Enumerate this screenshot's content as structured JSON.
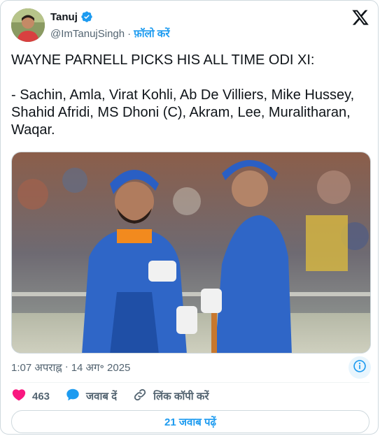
{
  "author": {
    "name": "Tanuj",
    "handle": "@ImTanujSingh",
    "follow_label": "फ़ॉलो करें",
    "separator": "·"
  },
  "tweet": {
    "text": "WAYNE PARNELL PICKS HIS ALL TIME ODI XI:\n\n- Sachin, Amla, Virat Kohli, Ab De Villiers, Mike Hussey, Shahid Afridi, MS Dhoni (C), Akram, Lee, Muralitharan, Waqar."
  },
  "meta": {
    "time": "1:07 अपराह्न",
    "separator": "·",
    "date": "14 अग॰ 2025"
  },
  "actions": {
    "like_count": "463",
    "reply_label": "जवाब दें",
    "copy_link_label": "लिंक कॉपी करें"
  },
  "replies_button": {
    "label": "21 जवाब पढ़ें"
  },
  "colors": {
    "accent": "#1d9bf0",
    "like": "#f91880",
    "text": "#0f1419",
    "muted": "#536471",
    "border": "#cfd9de"
  },
  "icons": {
    "verified": "verified-badge-icon",
    "x_logo": "x-logo-icon",
    "info": "info-icon",
    "heart": "heart-icon",
    "reply": "reply-bubble-icon",
    "link": "link-icon"
  }
}
